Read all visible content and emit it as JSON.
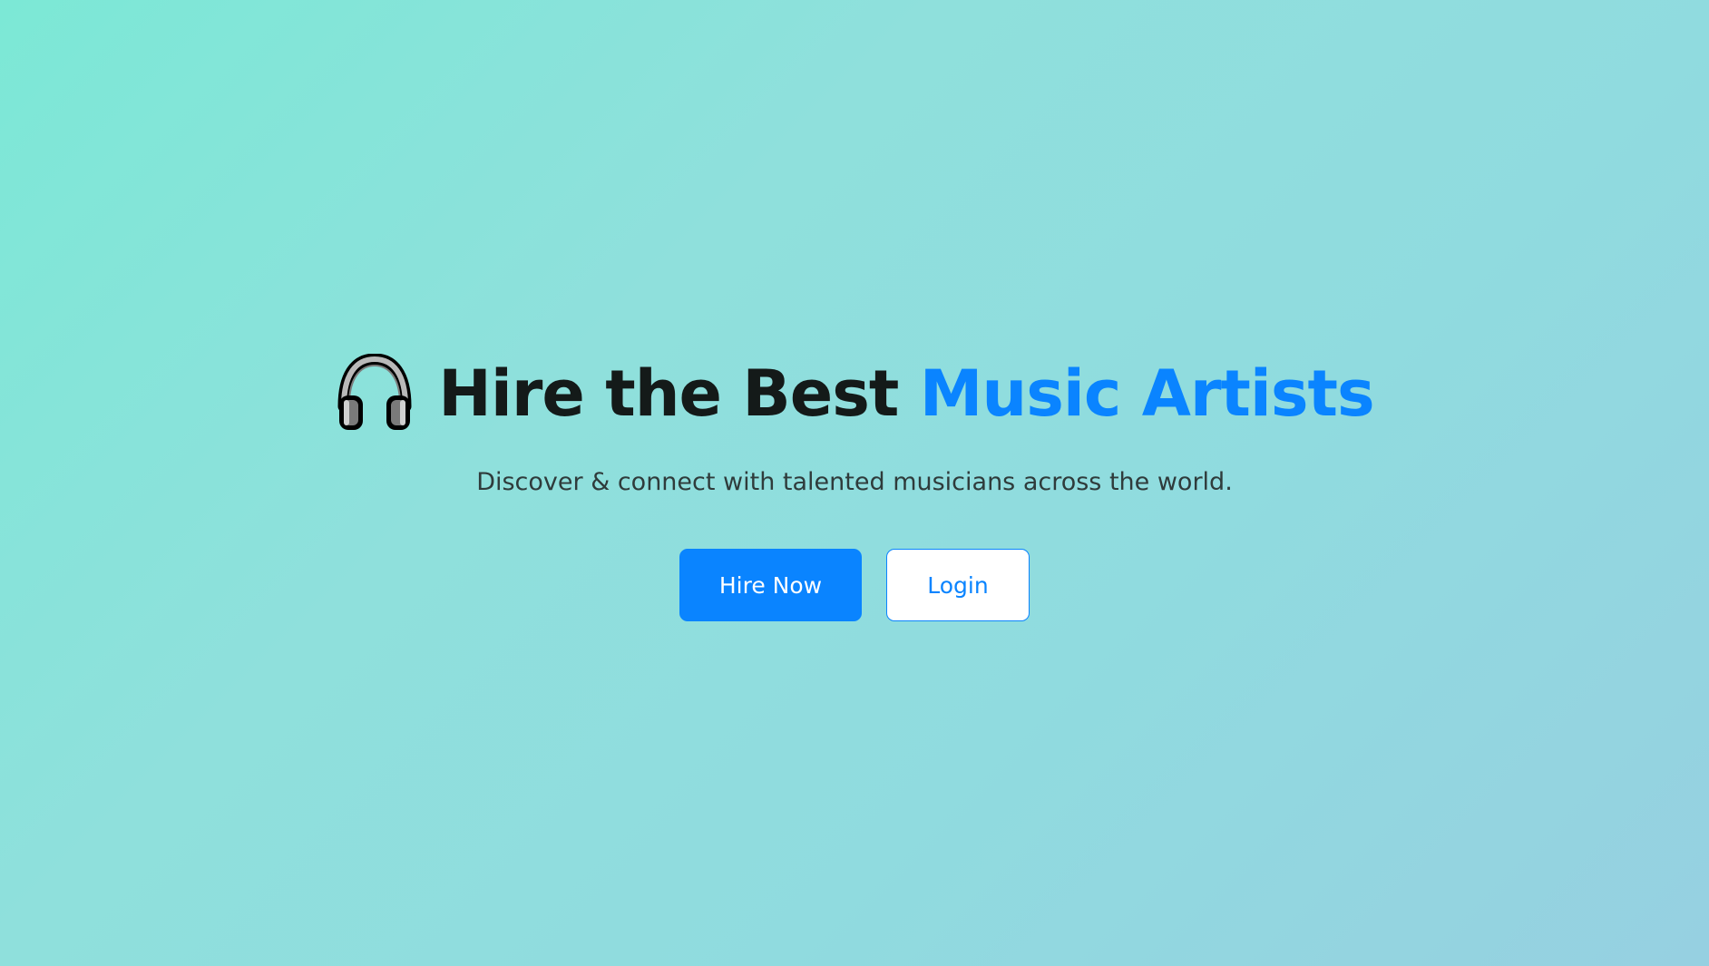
{
  "hero": {
    "icon": "headphones-icon",
    "title_main": "Hire the Best ",
    "title_accent": "Music Artists",
    "subtitle": "Discover & connect with talented musicians across the world.",
    "primary_button": "Hire Now",
    "secondary_button": "Login"
  },
  "colors": {
    "accent": "#0a84ff",
    "title_text": "#141a19",
    "subtitle_text": "#2f3b3b",
    "background_start": "#7ce8d6",
    "background_end": "#96d0e1"
  }
}
